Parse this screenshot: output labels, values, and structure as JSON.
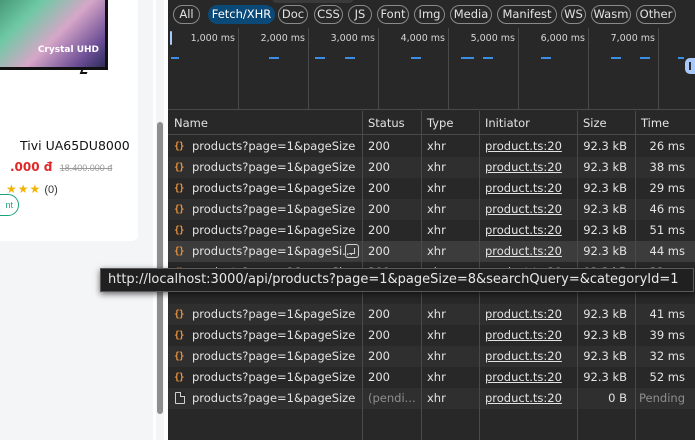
{
  "shop": {
    "image_brand": "Crystal UHD",
    "product_name": "Tivi UA65DU8000",
    "price_current": ".000 đ",
    "price_old": "18.400.000 đ",
    "stars": "★★★",
    "rating_count": "(0)",
    "button_label": "nt"
  },
  "devtools": {
    "filters": [
      "All",
      "Fetch/XHR",
      "Doc",
      "CSS",
      "JS",
      "Font",
      "Img",
      "Media",
      "Manifest",
      "WS",
      "Wasm",
      "Other"
    ],
    "active_filter": "Fetch/XHR",
    "timeline_ticks": [
      "1,000 ms",
      "2,000 ms",
      "3,000 ms",
      "4,000 ms",
      "5,000 ms",
      "6,000 ms",
      "7,000 ms"
    ],
    "columns": {
      "name": "Name",
      "status": "Status",
      "type": "Type",
      "initiator": "Initiator",
      "size": "Size",
      "time": "Time"
    },
    "rows": [
      {
        "name": "products?page=1&pageSize...",
        "status": "200",
        "type": "xhr",
        "initiator": "product.ts:20",
        "size": "92.3 kB",
        "time": "26 ms"
      },
      {
        "name": "products?page=1&pageSize...",
        "status": "200",
        "type": "xhr",
        "initiator": "product.ts:20",
        "size": "92.3 kB",
        "time": "38 ms"
      },
      {
        "name": "products?page=1&pageSize...",
        "status": "200",
        "type": "xhr",
        "initiator": "product.ts:20",
        "size": "92.3 kB",
        "time": "29 ms"
      },
      {
        "name": "products?page=1&pageSize...",
        "status": "200",
        "type": "xhr",
        "initiator": "product.ts:20",
        "size": "92.3 kB",
        "time": "46 ms"
      },
      {
        "name": "products?page=1&pageSize...",
        "status": "200",
        "type": "xhr",
        "initiator": "product.ts:20",
        "size": "92.3 kB",
        "time": "51 ms"
      },
      {
        "name": "products?page=1&pageSi...",
        "status": "200",
        "type": "xhr",
        "initiator": "product.ts:20",
        "size": "92.3 kB",
        "time": "44 ms"
      },
      {
        "name": "products?page=1&pageSize...",
        "status": "200",
        "type": "xhr",
        "initiator": "product.ts:20",
        "size": "92.3 kB",
        "time": "31 ms"
      },
      {
        "name": "products?page=1&pageSize...",
        "status": "200",
        "type": "xhr",
        "initiator": "product.ts:20",
        "size": "92.3 kB",
        "time": "41 ms"
      },
      {
        "name": "products?page=1&pageSize...",
        "status": "200",
        "type": "xhr",
        "initiator": "product.ts:20",
        "size": "92.3 kB",
        "time": "39 ms"
      },
      {
        "name": "products?page=1&pageSize...",
        "status": "200",
        "type": "xhr",
        "initiator": "product.ts:20",
        "size": "92.3 kB",
        "time": "32 ms"
      },
      {
        "name": "products?page=1&pageSize...",
        "status": "200",
        "type": "xhr",
        "initiator": "product.ts:20",
        "size": "92.3 kB",
        "time": "52 ms"
      },
      {
        "name": "products?page=1&pageSize...",
        "status": "(pendi...",
        "type": "xhr",
        "initiator": "product.ts:20",
        "size": "0 B",
        "time": "Pending"
      }
    ],
    "tooltip": "http://localhost:3000/api/products?page=1&pageSize=8&searchQuery=&categoryId=1",
    "accent_color": "#0b4a78",
    "js_icon_glyph": "{}"
  }
}
